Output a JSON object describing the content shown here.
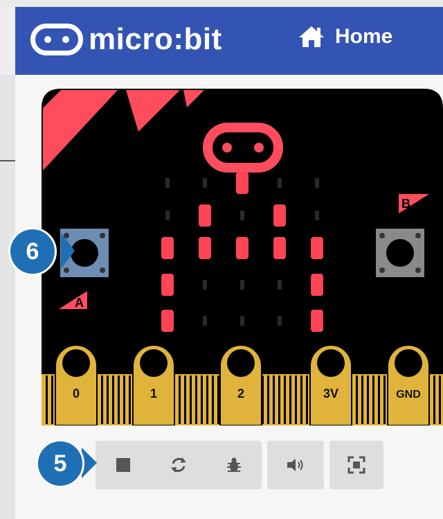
{
  "header": {
    "brand_label": "micro:bit",
    "home_label": "Home",
    "brand_color": "#3454b4"
  },
  "simulator": {
    "button_a_label": "A",
    "button_b_label": "B",
    "pins": [
      "0",
      "1",
      "2",
      "3V",
      "GND"
    ],
    "led_color": "#ff4456",
    "led_grid": [
      [
        0,
        0,
        1,
        0,
        0
      ],
      [
        0,
        1,
        0,
        1,
        0
      ],
      [
        1,
        1,
        1,
        1,
        1
      ],
      [
        1,
        0,
        0,
        0,
        1
      ],
      [
        1,
        0,
        0,
        0,
        1
      ]
    ]
  },
  "toolbar": {
    "stop_icon": "stop-icon",
    "restart_icon": "restart-icon",
    "debug_icon": "bug-icon",
    "sound_icon": "speaker-icon",
    "fullscreen_icon": "fullscreen-icon"
  },
  "callouts": {
    "callout_6": "6",
    "callout_5": "5"
  }
}
